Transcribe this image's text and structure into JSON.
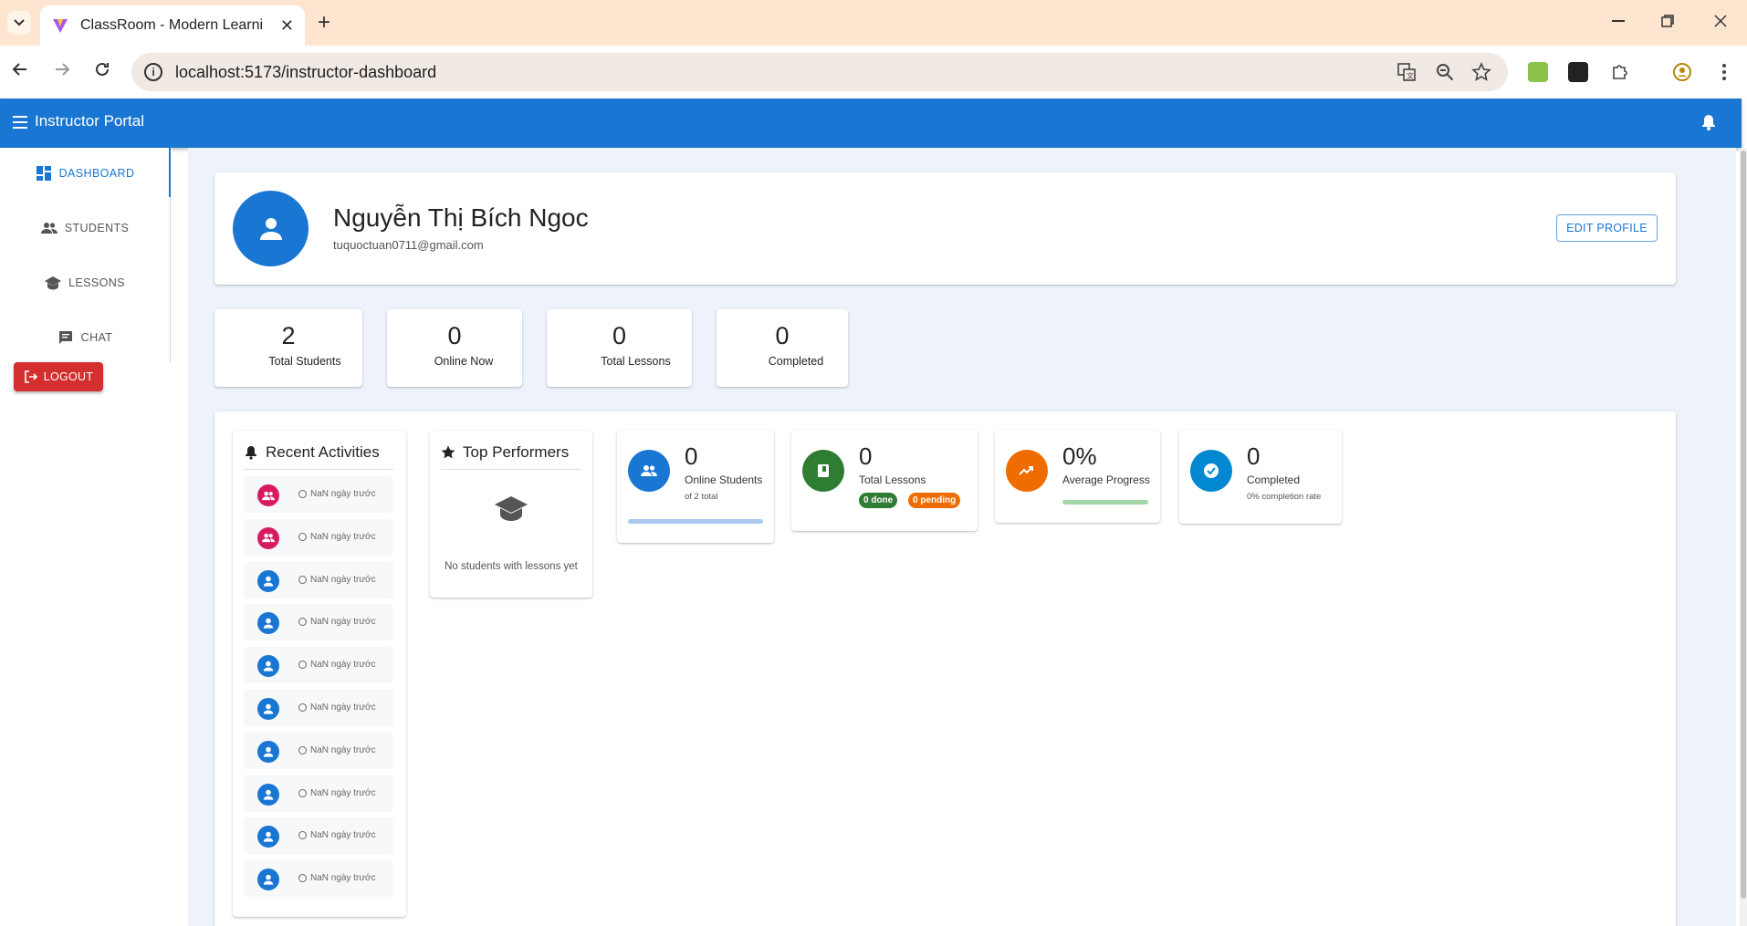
{
  "browser": {
    "tab_title": "ClassRoom - Modern Learning Platform",
    "url": "localhost:5173/instructor-dashboard",
    "new_tab": "+",
    "tab_close": "✕"
  },
  "appbar": {
    "title": "Instructor Portal"
  },
  "sidebar": {
    "items": [
      {
        "label": "DASHBOARD",
        "icon": "dashboard-icon"
      },
      {
        "label": "STUDENTS",
        "icon": "people-icon"
      },
      {
        "label": "LESSONS",
        "icon": "school-icon"
      },
      {
        "label": "CHAT",
        "icon": "chat-icon"
      }
    ],
    "logout_label": "LOGOUT"
  },
  "profile": {
    "name": "Nguyễn Thị Bích Ngoc",
    "email": "tuquoctuan0711@gmail.com",
    "edit_label": "EDIT PROFILE"
  },
  "stats": [
    {
      "value": "2",
      "label": "Total Students"
    },
    {
      "value": "0",
      "label": "Online Now"
    },
    {
      "value": "0",
      "label": "Total Lessons"
    },
    {
      "value": "0",
      "label": "Completed"
    }
  ],
  "recent": {
    "title": "Recent Activities",
    "items": [
      {
        "time": "NaN ngày trước",
        "type": "group"
      },
      {
        "time": "NaN ngày trước",
        "type": "group"
      },
      {
        "time": "NaN ngày trước",
        "type": "person"
      },
      {
        "time": "NaN ngày trước",
        "type": "person"
      },
      {
        "time": "NaN ngày trước",
        "type": "person"
      },
      {
        "time": "NaN ngày trước",
        "type": "person"
      },
      {
        "time": "NaN ngày trước",
        "type": "person"
      },
      {
        "time": "NaN ngày trước",
        "type": "person"
      },
      {
        "time": "NaN ngày trước",
        "type": "person"
      },
      {
        "time": "NaN ngày trước",
        "type": "person"
      }
    ]
  },
  "top_performers": {
    "title": "Top Performers",
    "empty": "No students with lessons yet"
  },
  "metrics": {
    "online": {
      "value": "0",
      "label": "Online Students",
      "sub": "of 2 total",
      "progress": 0
    },
    "lessons": {
      "value": "0",
      "label": "Total Lessons",
      "done": "0 done",
      "pending": "0 pending"
    },
    "progress": {
      "value": "0%",
      "label": "Average Progress",
      "progress": 0
    },
    "completed": {
      "value": "0",
      "label": "Completed",
      "sub": "0% completion rate"
    }
  },
  "colors": {
    "primary": "#1976d2",
    "danger": "#d32f2f",
    "success": "#2e7d32",
    "warning": "#ef6c00",
    "pink": "#d81b60",
    "info": "#0288d1"
  }
}
